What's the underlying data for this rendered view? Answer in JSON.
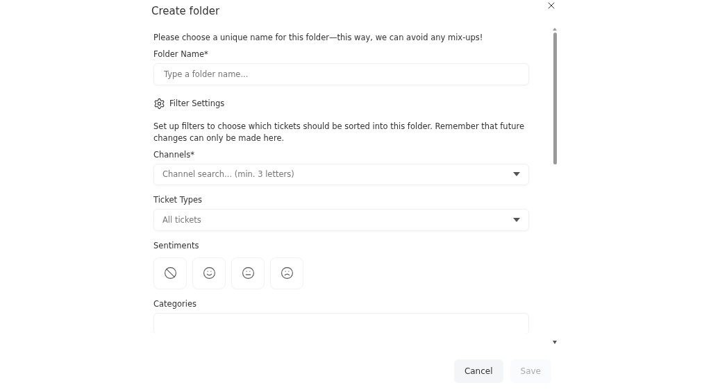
{
  "dialog": {
    "title": "Create folder"
  },
  "intro": "Please choose a unique name for this folder—this way, we can avoid any mix-ups!",
  "folder_name": {
    "label": "Folder Name*",
    "placeholder": "Type a folder name..."
  },
  "filter_settings": {
    "title": "Filter Settings",
    "description": "Set up filters to choose which tickets should be sorted into this folder. Remember that future changes can only be made here."
  },
  "channels": {
    "label": "Channels*",
    "placeholder": "Channel search... (min. 3 letters)"
  },
  "ticket_types": {
    "label": "Ticket Types",
    "value": "All tickets"
  },
  "sentiments": {
    "label": "Sentiments",
    "options": [
      {
        "kind": "none",
        "selected": false
      },
      {
        "kind": "positive",
        "selected": false
      },
      {
        "kind": "neutral",
        "selected": false
      },
      {
        "kind": "negative",
        "selected": false
      }
    ]
  },
  "categories": {
    "label": "Categories"
  },
  "buttons": [
    {
      "label": "Cancel",
      "disabled": false
    },
    {
      "label": "Save",
      "disabled": true
    }
  ]
}
